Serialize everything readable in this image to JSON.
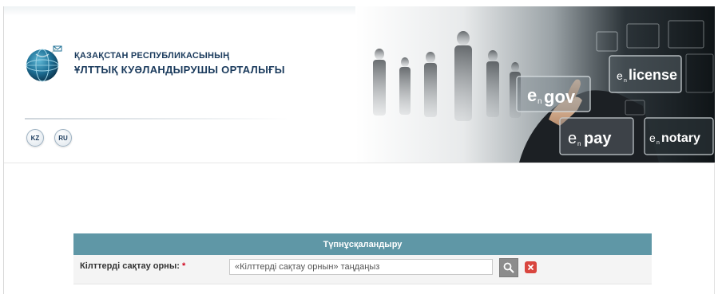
{
  "header": {
    "org_line1": "ҚАЗАҚСТАН РЕСПУБЛИКАСЫНЫҢ",
    "org_line2": "ҰЛТТЫҚ КУӘЛАНДЫРУШЫ ОРТАЛЫҒЫ",
    "languages": [
      "KZ",
      "RU"
    ]
  },
  "banner": {
    "tiles": [
      "egov",
      "elicense",
      "epay",
      "enotary"
    ]
  },
  "form": {
    "title": "Түпнұсқаландыру",
    "key_storage_label": "Кілттерді сақтау орны:",
    "required_mark": "*",
    "key_storage_placeholder": "«Кілттерді сақтау орнын» таңдаңыз"
  },
  "colors": {
    "form_header_bg": "#5f97a6",
    "brand_text": "#1a3a5c",
    "clear_button": "#d9463f",
    "required": "#d0021b"
  }
}
